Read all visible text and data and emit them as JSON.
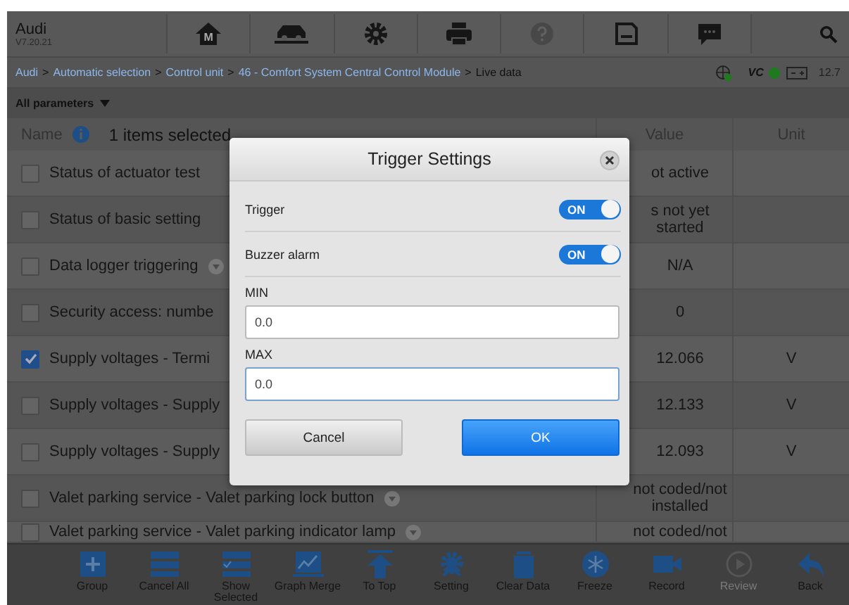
{
  "app": {
    "title": "Audi",
    "version": "V7.20.21"
  },
  "toolbar": [
    {
      "kind": "home",
      "label": "M",
      "disabled": false
    },
    {
      "kind": "lift",
      "disabled": false
    },
    {
      "kind": "gear",
      "disabled": false
    },
    {
      "kind": "printer",
      "disabled": false
    },
    {
      "kind": "help",
      "disabled": true
    },
    {
      "kind": "save",
      "disabled": false
    },
    {
      "kind": "chat",
      "disabled": false
    }
  ],
  "breadcrumb": [
    {
      "text": "Audi",
      "link": true
    },
    {
      "text": ">",
      "link": false
    },
    {
      "text": "Automatic selection",
      "link": true
    },
    {
      "text": ">",
      "link": false
    },
    {
      "text": "Control unit",
      "link": true
    },
    {
      "text": ">",
      "link": false
    },
    {
      "text": "46 - Comfort System Central Control Module",
      "link": true
    },
    {
      "text": ">",
      "link": false
    },
    {
      "text": "Live data",
      "link": false
    }
  ],
  "status": {
    "vc": "VC",
    "battery": "12.7"
  },
  "filter": {
    "label": "All parameters"
  },
  "table": {
    "columns": [
      "Name",
      "Value",
      "Unit"
    ],
    "selection_note": "1 items selected",
    "rows": [
      {
        "name": "Status of actuator test",
        "checked": false,
        "menu": false,
        "value": "ot active",
        "unit": ""
      },
      {
        "name": "Status of basic setting",
        "checked": false,
        "menu": false,
        "value": "s not yet started",
        "unit": ""
      },
      {
        "name": "Data logger triggering",
        "checked": false,
        "menu": true,
        "value": "N/A",
        "unit": ""
      },
      {
        "name": "Security access: numbe",
        "checked": false,
        "menu": false,
        "value": "0",
        "unit": ""
      },
      {
        "name": "Supply voltages - Termi",
        "checked": true,
        "menu": false,
        "value": "12.066",
        "unit": "V"
      },
      {
        "name": "Supply voltages - Supply",
        "checked": false,
        "value": "12.133",
        "unit": "V"
      },
      {
        "name": "Supply voltages - Supply",
        "checked": false,
        "value": "12.093",
        "unit": "V"
      },
      {
        "name": "Valet parking service - Valet parking lock button",
        "checked": false,
        "menu": true,
        "value": "not coded/not installed",
        "unit": ""
      },
      {
        "name": "Valet parking service - Valet parking indicator lamp",
        "checked": false,
        "menu": true,
        "value": "not coded/not",
        "unit": ""
      }
    ]
  },
  "dialog": {
    "title": "Trigger Settings",
    "toggles": [
      {
        "label": "Trigger",
        "on": true,
        "state": "ON"
      },
      {
        "label": "Buzzer alarm",
        "on": true,
        "state": "ON"
      }
    ],
    "fields": [
      {
        "label": "MIN",
        "value": "0.0",
        "focused": false
      },
      {
        "label": "MAX",
        "value": "0.0",
        "focused": true
      }
    ],
    "buttons": [
      {
        "label": "Cancel",
        "primary": false
      },
      {
        "label": "OK",
        "primary": true
      }
    ]
  },
  "bottom_bar": [
    {
      "kind": "plus",
      "label": "Group",
      "disabled": false
    },
    {
      "kind": "list",
      "label": "Cancel All",
      "disabled": false
    },
    {
      "kind": "checklist",
      "label": "Show Selected",
      "disabled": false
    },
    {
      "kind": "chart",
      "label": "Graph Merge",
      "disabled": false
    },
    {
      "kind": "top",
      "label": "To Top",
      "disabled": false
    },
    {
      "kind": "gear",
      "label": "Setting",
      "disabled": false
    },
    {
      "kind": "trash",
      "label": "Clear Data",
      "disabled": false
    },
    {
      "kind": "snow",
      "label": "Freeze",
      "disabled": false
    },
    {
      "kind": "camera",
      "label": "Record",
      "disabled": false
    },
    {
      "kind": "play",
      "label": "Review",
      "disabled": true
    },
    {
      "kind": "back",
      "label": "Back",
      "disabled": false
    }
  ]
}
